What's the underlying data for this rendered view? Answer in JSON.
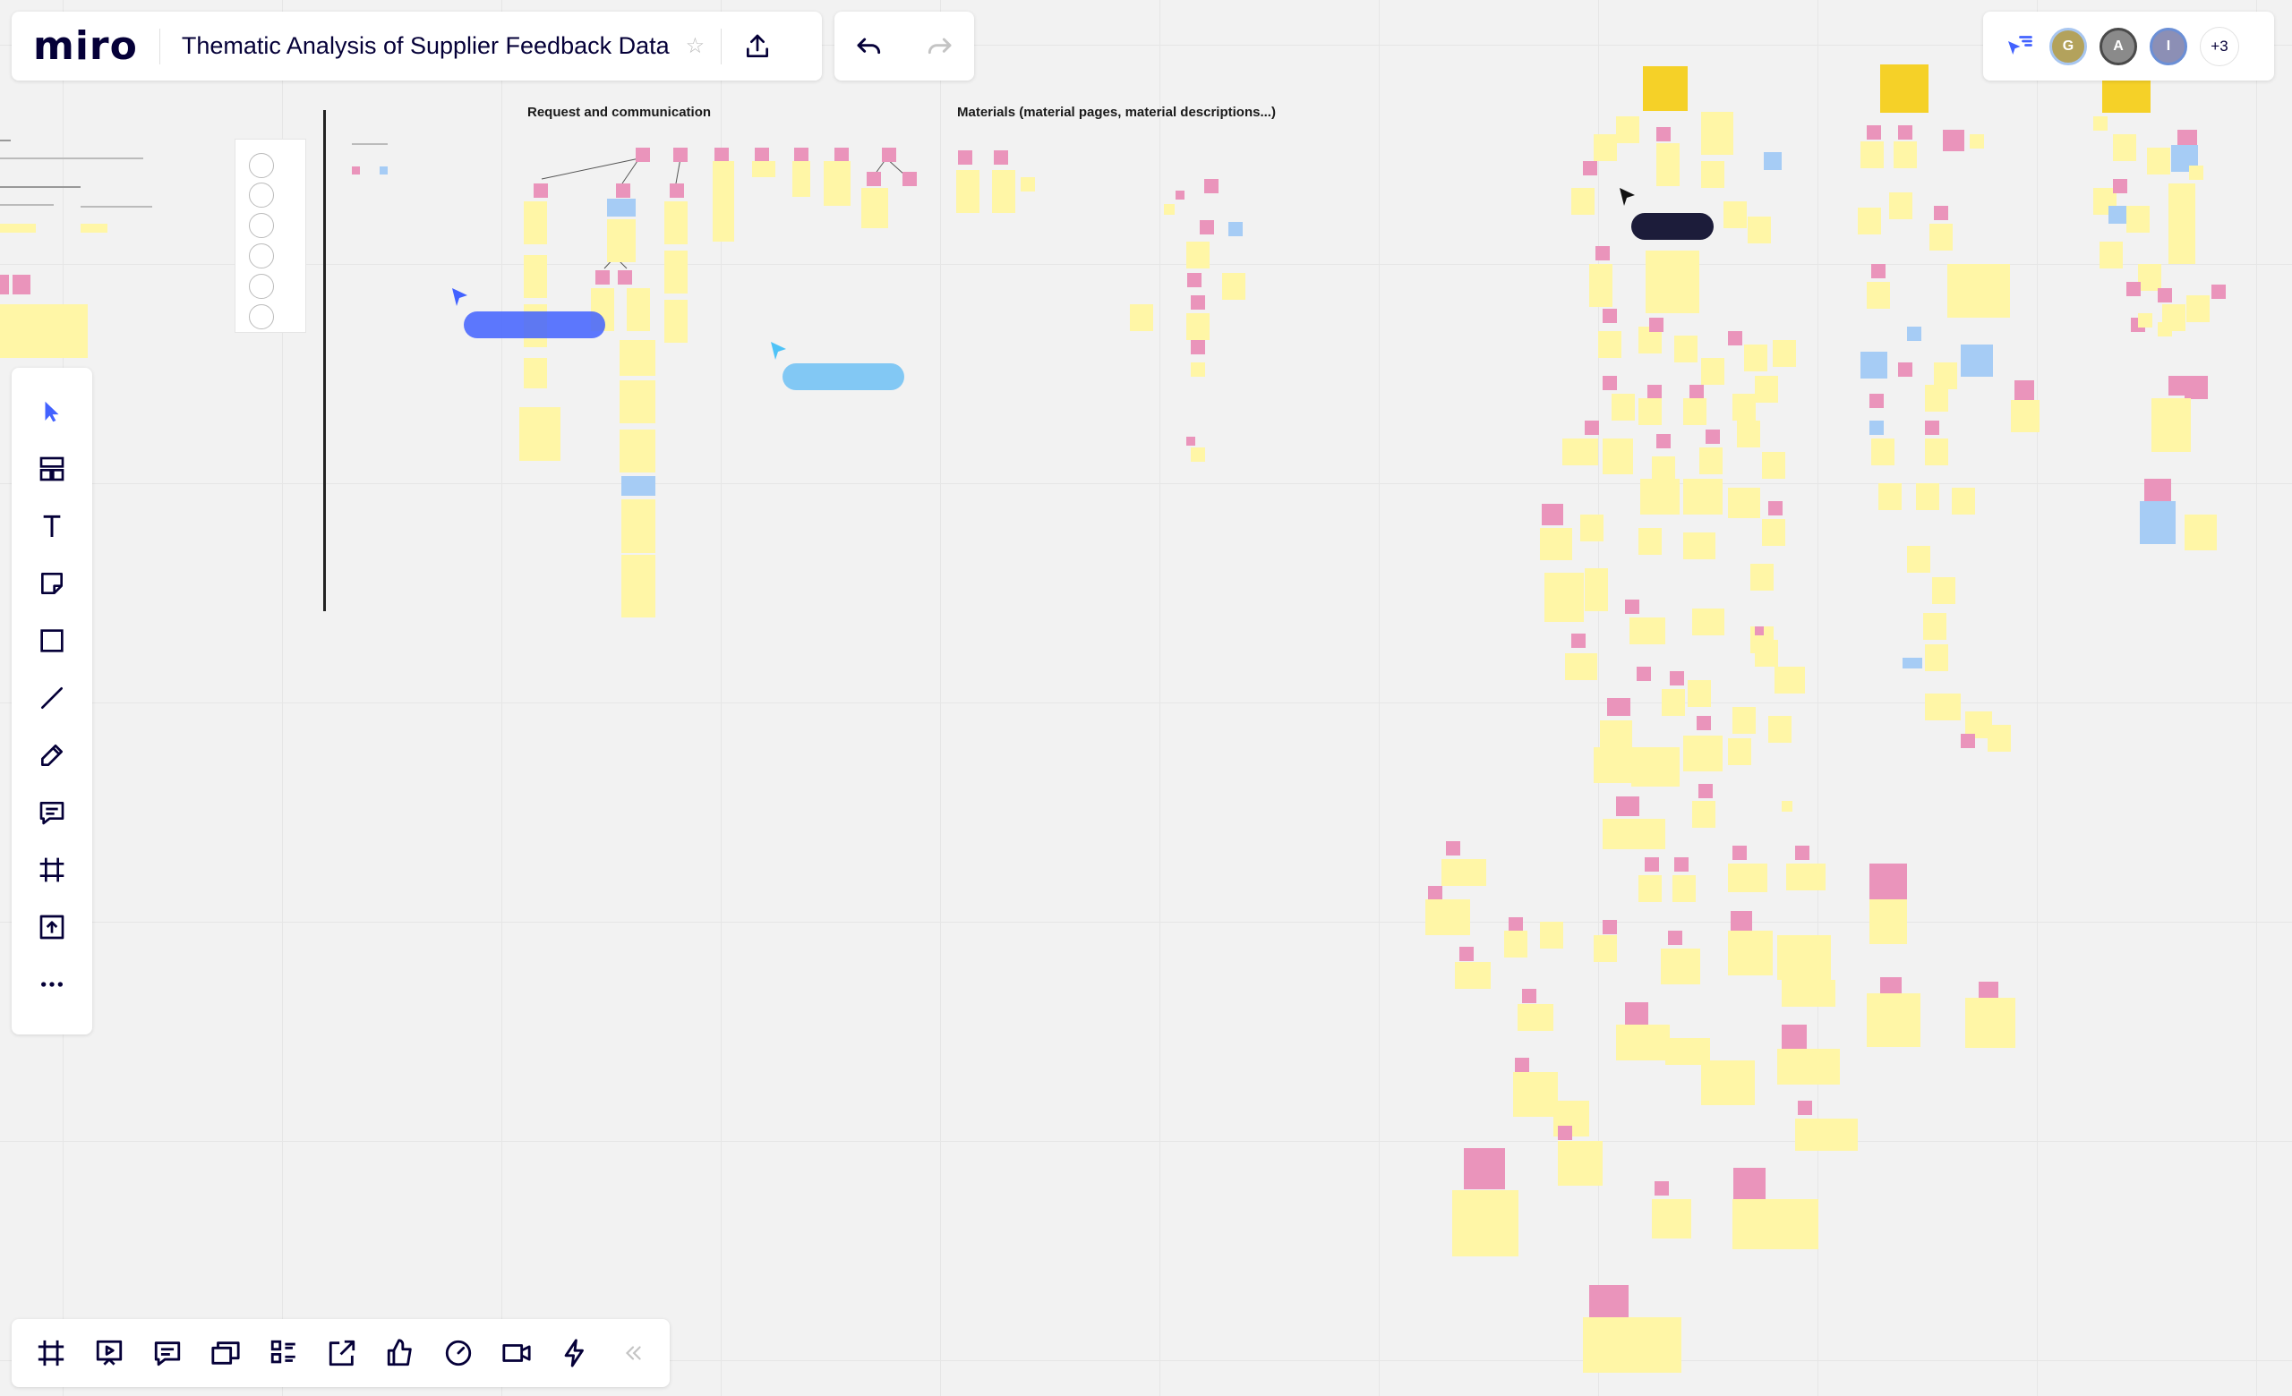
{
  "app": {
    "logo": "miro",
    "board_title": "Thematic Analysis of Supplier Feedback Data"
  },
  "collaborators": {
    "avatars": [
      {
        "initial": "G",
        "color": "#b3a25c",
        "ring": "#a8c6f0"
      },
      {
        "initial": "A",
        "color": "#8a8a8a",
        "ring": "#4a4a4a"
      },
      {
        "initial": "I",
        "color": "#8c8fb5",
        "ring": "#6b8fd6"
      }
    ],
    "more_count": "+3"
  },
  "canvas": {
    "sections": {
      "request": "Request and communication",
      "materials": "Materials (material pages, material descriptions...)"
    },
    "colors": {
      "note_yellow": "#fff6a6",
      "note_pink": "#ea94bb",
      "note_blue": "#a6ccf5",
      "note_orange": "#f5d128",
      "accent": "#4262ff"
    }
  },
  "left_toolbar": [
    {
      "icon": "select-arrow-icon"
    },
    {
      "icon": "templates-icon"
    },
    {
      "icon": "text-icon"
    },
    {
      "icon": "sticky-note-icon"
    },
    {
      "icon": "shape-icon"
    },
    {
      "icon": "line-icon"
    },
    {
      "icon": "pen-icon"
    },
    {
      "icon": "comment-icon"
    },
    {
      "icon": "frame-icon"
    },
    {
      "icon": "upload-icon"
    },
    {
      "icon": "more-icon"
    }
  ],
  "bottom_toolbar": [
    {
      "icon": "frames-icon"
    },
    {
      "icon": "present-icon"
    },
    {
      "icon": "comments-icon"
    },
    {
      "icon": "cards-icon"
    },
    {
      "icon": "board-outline-icon"
    },
    {
      "icon": "share-out-icon"
    },
    {
      "icon": "thumbs-up-icon"
    },
    {
      "icon": "timer-icon"
    },
    {
      "icon": "video-icon"
    },
    {
      "icon": "lightning-icon"
    },
    {
      "icon": "collapse-icon"
    }
  ]
}
